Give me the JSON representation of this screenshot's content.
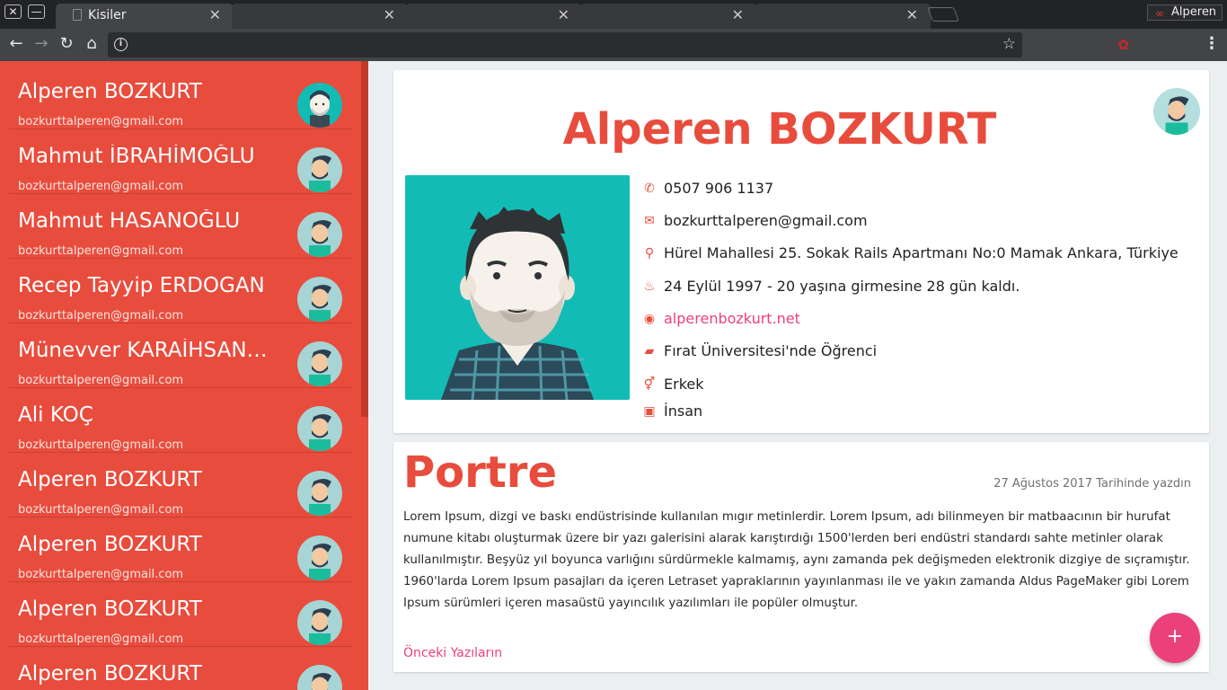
{
  "browser": {
    "tabs": [
      {
        "title": "Kisiler",
        "close": "✕"
      },
      {
        "title": "",
        "close": "✕"
      },
      {
        "title": "",
        "close": "✕"
      },
      {
        "title": "",
        "close": "✕"
      },
      {
        "title": "",
        "close": "✕"
      }
    ],
    "profile_name": "Alperen",
    "window_close": "✕",
    "window_minimize": "—",
    "icons": {
      "back": "←",
      "forward": "→",
      "reload": "↻",
      "home": "⌂",
      "info": "i",
      "star": "☆",
      "extension": "✿",
      "menu": "⋮",
      "profile": "∞"
    }
  },
  "sidebar": {
    "contacts": [
      {
        "name": "Alperen BOZKURT",
        "email": "bozkurttalperen@gmail.com"
      },
      {
        "name": "Mahmut İBRAHİMOĞLU",
        "email": "bozkurttalperen@gmail.com"
      },
      {
        "name": "Mahmut HASANOĞLU",
        "email": "bozkurttalperen@gmail.com"
      },
      {
        "name": "Recep Tayyip ERDOGAN",
        "email": "bozkurttalperen@gmail.com"
      },
      {
        "name": "Münevver KARAİHSANOĞLU",
        "email": "bozkurttalperen@gmail.com"
      },
      {
        "name": "Ali KOÇ",
        "email": "bozkurttalperen@gmail.com"
      },
      {
        "name": "Alperen BOZKURT",
        "email": "bozkurttalperen@gmail.com"
      },
      {
        "name": "Alperen BOZKURT",
        "email": "bozkurttalperen@gmail.com"
      },
      {
        "name": "Alperen BOZKURT",
        "email": "bozkurttalperen@gmail.com"
      },
      {
        "name": "Alperen BOZKURT",
        "email": ""
      }
    ]
  },
  "profile": {
    "name": "Alperen BOZKURT",
    "phone": "0507 906 1137",
    "email": "bozkurttalperen@gmail.com",
    "address": "Hürel Mahallesi 25. Sokak Rails Apartmanı No:0 Mamak Ankara, Türkiye",
    "birthday": "24 Eylül 1997 - 20 yaşına girmesine 28 gün kaldı.",
    "website": "alperenbozkurt.net",
    "occupation": "Fırat Üniversitesi'nde Öğrenci",
    "gender": "Erkek",
    "species": "İnsan",
    "icons": {
      "phone": "✆",
      "email": "✉",
      "address": "⚲",
      "birthday": "♨",
      "website": "◉",
      "occupation": "▰",
      "gender": "⚥",
      "species": "▣"
    }
  },
  "post": {
    "title": "Portre",
    "date": "27 Ağustos 2017 Tarihinde yazdın",
    "body": "Lorem Ipsum, dizgi ve baskı endüstrisinde kullanılan mıgır metinlerdir. Lorem Ipsum, adı bilinmeyen bir matbaacının bir hurufat numune kitabı oluşturmak üzere bir yazı galerisini alarak karıştırdığı 1500'lerden beri endüstri standardı sahte metinler olarak kullanılmıştır. Beşyüz yıl boyunca varlığını sürdürmekle kalmamış, aynı zamanda pek değişmeden elektronik dizgiye de sıçramıştır. 1960'larda Lorem Ipsum pasajları da içeren Letraset yapraklarının yayınlanması ile ve yakın zamanda Aldus PageMaker gibi Lorem Ipsum sürümleri içeren masaüstü yayıncılık yazılımları ile popüler olmuştur.",
    "prev_link": "Önceki Yazıların",
    "fab_label": "+"
  }
}
